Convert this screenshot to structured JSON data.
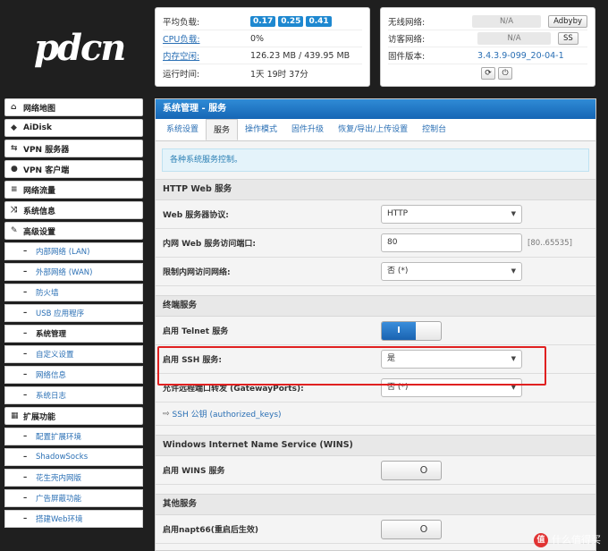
{
  "logo_text": "pdcn",
  "status_left": {
    "rows": [
      {
        "key": "平均负载:",
        "badges": [
          "0.17",
          "0.25",
          "0.41"
        ]
      },
      {
        "key": "CPU负载:",
        "value": "0%"
      },
      {
        "key": "内存空闲:",
        "value": "126.23 MB / 439.95 MB"
      },
      {
        "key": "运行时间:",
        "value": "1天 19时 37分"
      }
    ]
  },
  "status_right": {
    "wireless": {
      "key": "无线网络:",
      "value": "N/A",
      "button": "Adbyby"
    },
    "guest": {
      "key": "访客网络:",
      "value": "N/A",
      "button": "SS"
    },
    "firmware": {
      "key": "固件版本:",
      "value": "3.4.3.9-099_20-04-1"
    },
    "icons": [
      "refresh-icon",
      "power-icon"
    ]
  },
  "sidebar": {
    "items": [
      {
        "label": "网络地图",
        "icon": "home-icon"
      },
      {
        "label": "AiDisk",
        "icon": "disk-icon"
      },
      {
        "label": "VPN 服务器",
        "icon": "swap-icon"
      },
      {
        "label": "VPN 客户端",
        "icon": "globe-icon"
      },
      {
        "label": "网络流量",
        "icon": "list-icon"
      },
      {
        "label": "系统信息",
        "icon": "shuffle-icon"
      },
      {
        "label": "高级设置",
        "icon": "wrench-icon"
      }
    ],
    "advanced_subs": [
      "内部网络 (LAN)",
      "外部网络 (WAN)",
      "防火墙",
      "USB 应用程序",
      "系统管理",
      "自定义设置",
      "网络信息",
      "系统日志"
    ],
    "active_sub": "系统管理",
    "ext_header": {
      "label": "扩展功能",
      "icon": "grid-icon"
    },
    "ext_subs": [
      "配置扩展环境",
      "ShadowSocks",
      "花生壳内网版",
      "广告屏蔽功能",
      "搭建Web环境"
    ]
  },
  "main": {
    "title": "系统管理 - 服务",
    "tabs": [
      "系统设置",
      "服务",
      "操作模式",
      "固件升级",
      "恢复/导出/上传设置",
      "控制台"
    ],
    "active_tab": "服务",
    "info": "各种系统服务控制。",
    "http_section": "HTTP Web 服务",
    "http_rows": [
      {
        "label": "Web 服务器协议:",
        "value": "HTTP"
      },
      {
        "label": "内网 Web 服务访问端口:",
        "value": "80",
        "hint": "[80..65535]"
      },
      {
        "label": "限制内网访问网络:",
        "value": "否 (*)"
      }
    ],
    "terminal_section": "终端服务",
    "telnet_label": "启用 Telnet 服务",
    "toggle_on_text": "I",
    "ssh_label": "启用 SSH 服务:",
    "ssh_value": "是",
    "gateway_label": "允许远程端口转发 (GatewayPorts):",
    "gateway_value": "否 (*)",
    "ssh_key_link": "SSH 公钥 (authorized_keys)",
    "wins_section": "Windows Internet Name Service (WINS)",
    "wins_label": "启用 WINS 服务",
    "other_section": "其他服务",
    "napt_label": "启用napt66(重启后生效)",
    "toggle_off_text": "O"
  },
  "watermark": {
    "badge": "值",
    "text": "什么值得买"
  }
}
